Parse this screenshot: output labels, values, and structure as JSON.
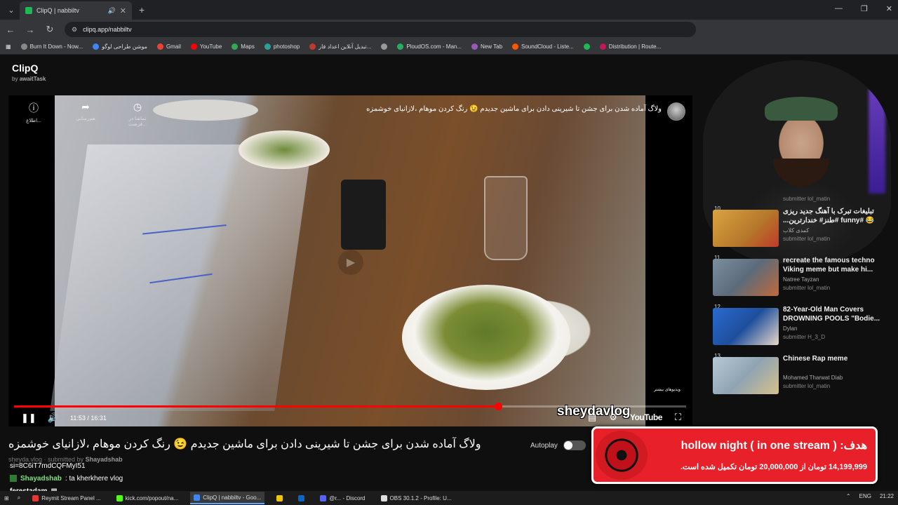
{
  "browser": {
    "tab_title": "ClipQ | nabbiltv",
    "url": "clipq.app/nabbiltv",
    "bookmarks": [
      {
        "label": "Burn It Down - Now...",
        "color": "#888"
      },
      {
        "label": "موشن طراحی لوگو",
        "color": "#4285f4"
      },
      {
        "label": "Gmail",
        "color": "#ea4335"
      },
      {
        "label": "YouTube",
        "color": "#ff0000"
      },
      {
        "label": "Maps",
        "color": "#34a853"
      },
      {
        "label": "photoshop",
        "color": "#2aa198"
      },
      {
        "label": "تبدیل آنلاین اعداد فار...",
        "color": "#c0392b"
      },
      {
        "label": "",
        "color": "#999"
      },
      {
        "label": "PloudOS.com - Man...",
        "color": "#27ae60"
      },
      {
        "label": "New Tab",
        "color": "#9b59b6"
      },
      {
        "label": "SoundCloud - Liste...",
        "color": "#ff5500"
      },
      {
        "label": "",
        "color": "#1db954"
      },
      {
        "label": "Distribution | Route...",
        "color": "#c2185b"
      },
      {
        "label": "",
        "color": "#777"
      }
    ]
  },
  "app": {
    "name": "ClipQ",
    "by_label": "by",
    "by_author": "awaitTask"
  },
  "player": {
    "tools": [
      {
        "icon": "info-icon",
        "glyph": "ℹ",
        "label": "اطلاع..."
      },
      {
        "icon": "share-icon",
        "glyph": "➦",
        "label": "هم‌رسانی"
      },
      {
        "icon": "clock-icon",
        "glyph": "🕓",
        "label": "تماشا در فرصت..."
      }
    ],
    "title": "ولاگ آماده شدن برای جشن تا شیرینی دادن برای ماشین جدیدم 😉 رنگ کردن موهام ،لازانیای خوشمزه",
    "more_videos": "ویدیوهای بیشتر",
    "time": "11:53 / 16:31",
    "progress": 0.72,
    "watermark": "sheydavlog",
    "youtube_label": "YouTube"
  },
  "video": {
    "title": "ولاگ آماده شدن برای جشن تا شیرینی دادن برای ماشین جدیدم 😉 رنگ کردن موهام ،لازانیای خوشمزه",
    "autoplay_label": "Autoplay",
    "submitter_prefix": "sheyda.vlog · submitted by",
    "submitter": "Shayadshab"
  },
  "chat": [
    {
      "user": "",
      "text": "si=8C6iT7mdCQFMyI51"
    },
    {
      "user": "Shayadshab",
      "text": ": ta kherkhere vlog"
    },
    {
      "user": "ferestadam",
      "text": ""
    }
  ],
  "goal": {
    "line1": "هدف: ( hollow night ( in one stream",
    "line2": "14,199,999 تومان از 20,000,000 تومان تکمیل شده است."
  },
  "queue": [
    {
      "num": "10",
      "title": "تبلیغات تبرک با آهنگ جدید ریزی 😂 #funny #طنز# خندارترین...",
      "rtl": true,
      "channel": "کمدی کلاب",
      "submitter": "submitter lol_matin",
      "thumb": "#b5762a"
    },
    {
      "num": "11",
      "title": "recreate the famous techno Viking meme but make hi...",
      "rtl": false,
      "channel": "Natree Tayzan",
      "submitter": "submitter lol_matin",
      "thumb": "#5c6b7a"
    },
    {
      "num": "12",
      "title": "82-Year-Old Man Covers DROWNING POOLS \"Bodie...",
      "rtl": false,
      "channel": "Dylan",
      "submitter": "submitter H_3_D",
      "thumb": "#1e4f9c"
    },
    {
      "num": "13",
      "title": "Chinese Rap meme",
      "rtl": false,
      "channel": "Mohamed Tharwat Diab",
      "submitter": "submitter lol_matin",
      "thumb": "#8fa4b3"
    }
  ],
  "queue_prev_submitter": "submitter lol_matin",
  "taskbar": {
    "items": [
      {
        "label": "Reymit Stream Panel ...",
        "color": "#e53935",
        "active": false
      },
      {
        "label": "kick.com/popout/na...",
        "color": "#53fc18",
        "active": false
      },
      {
        "label": "ClipQ | nabbiltv - Goo...",
        "color": "#4285f4",
        "active": true
      },
      {
        "label": "",
        "color": "#f1c40f",
        "active": false
      },
      {
        "label": "",
        "color": "#0a66c2",
        "active": false
      },
      {
        "label": "@r... - Discord",
        "color": "#5865f2",
        "active": false
      },
      {
        "label": "OBS 30.1.2 - Profile: U...",
        "color": "#ddd",
        "active": false
      }
    ],
    "lang": "ENG",
    "clock": "21:22"
  }
}
